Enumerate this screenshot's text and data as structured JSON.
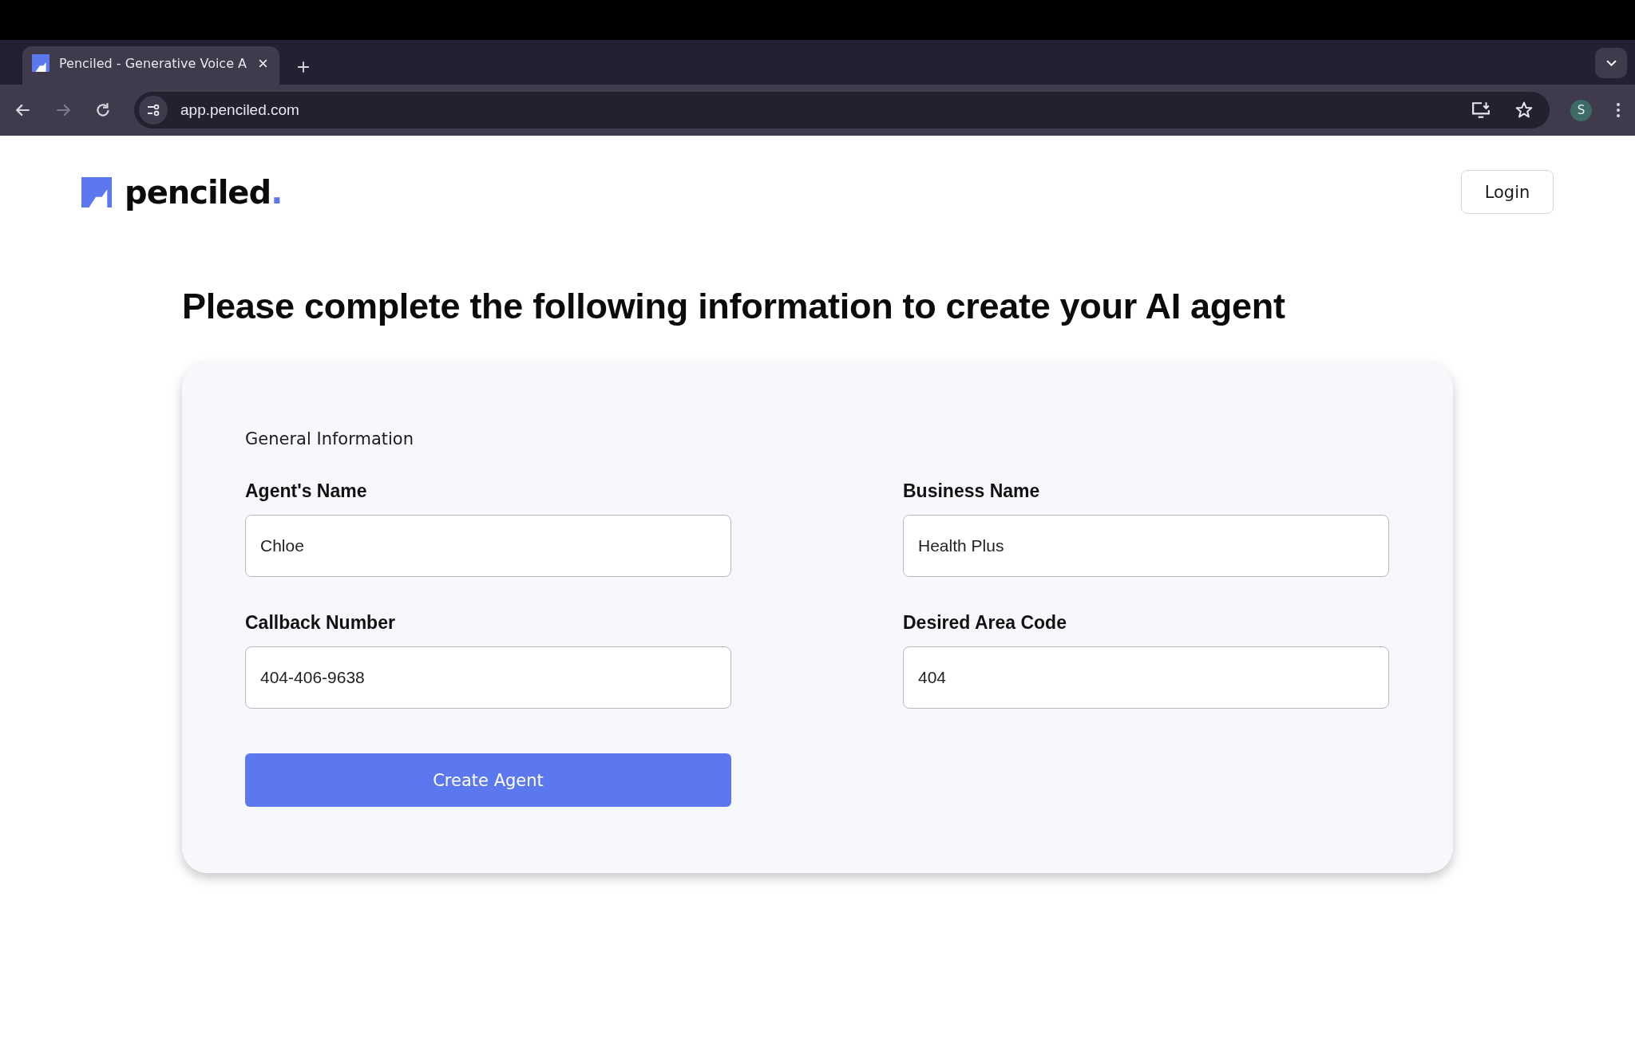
{
  "browser": {
    "tabs": [
      {
        "title": "Penciled - Generative Voice A",
        "selected": true
      }
    ],
    "address": "app.penciled.com",
    "profile_initial": "S"
  },
  "header": {
    "logo": {
      "name": "penciled",
      "dot": "."
    },
    "login": "Login"
  },
  "heading": "Please complete the following information to create your AI agent",
  "form": {
    "section": "General Information",
    "fields": [
      {
        "label": "Agent's Name",
        "value": "Chloe"
      },
      {
        "label": "Business Name",
        "value": "Health Plus"
      },
      {
        "label": "Callback Number",
        "value": "404-406-9638"
      },
      {
        "label": "Desired Area Code",
        "value": "404"
      }
    ],
    "submit": "Create Agent"
  }
}
